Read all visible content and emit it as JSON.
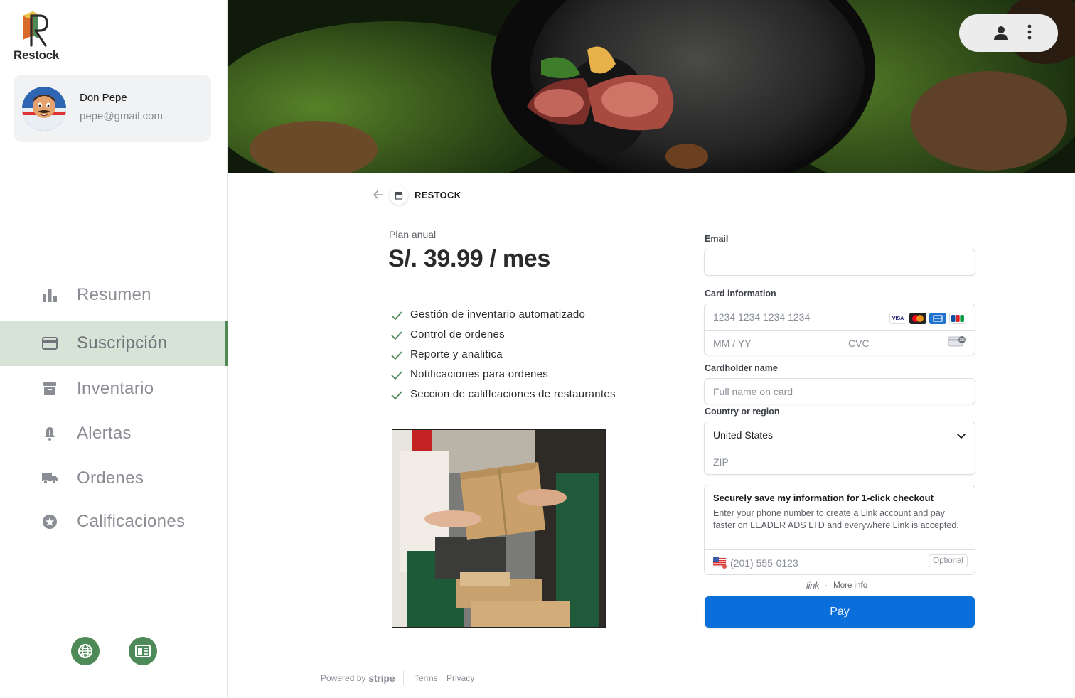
{
  "app": {
    "name": "Restock"
  },
  "user": {
    "name": "Don Pepe",
    "email": "pepe@gmail.com"
  },
  "nav": {
    "items": [
      {
        "label": "Resumen",
        "icon": "bar-chart-icon"
      },
      {
        "label": "Suscripción",
        "icon": "credit-card-icon",
        "active": true
      },
      {
        "label": "Inventario",
        "icon": "archive-icon"
      },
      {
        "label": "Alertas",
        "icon": "bell-icon"
      },
      {
        "label": "Ordenes",
        "icon": "truck-icon"
      },
      {
        "label": "Calificaciones",
        "icon": "star-icon"
      }
    ],
    "bottom": [
      {
        "icon": "globe-icon"
      },
      {
        "icon": "newspaper-icon"
      }
    ]
  },
  "checkout": {
    "merchant": "RESTOCK",
    "plan_name": "Plan anual",
    "price": "S/. 39.99 / mes",
    "features": [
      "Gestión de inventario automatizado",
      "Control de ordenes",
      "Reporte y analitica",
      "Notificaciones para ordenes",
      "Seccion de califfcaciones de restaurantes"
    ]
  },
  "form": {
    "email_label": "Email",
    "email_value": "",
    "card_label": "Card information",
    "card_number_placeholder": "1234 1234 1234 1234",
    "expiry_placeholder": "MM / YY",
    "cvc_placeholder": "CVC",
    "card_brands": [
      "VISA",
      "mastercard",
      "amex",
      "JCB"
    ],
    "cardholder_label": "Cardholder name",
    "cardholder_placeholder": "Full name on card",
    "country_label": "Country or region",
    "country_value": "United States",
    "zip_placeholder": "ZIP",
    "link_title": "Securely save my information for 1-click checkout",
    "link_desc": "Enter your phone number to create a Link account and pay faster on LEADER ADS LTD and everywhere Link is accepted.",
    "phone_placeholder": "(201) 555-0123",
    "optional_label": "Optional",
    "link_logo": "link",
    "more_info": "More info",
    "pay_label": "Pay"
  },
  "footer": {
    "powered_by": "Powered by",
    "stripe": "stripe",
    "terms": "Terms",
    "privacy": "Privacy"
  },
  "colors": {
    "accent_green": "#4e8a58",
    "active_bg": "#d7e3d6",
    "pay_blue": "#0a6fdb"
  }
}
